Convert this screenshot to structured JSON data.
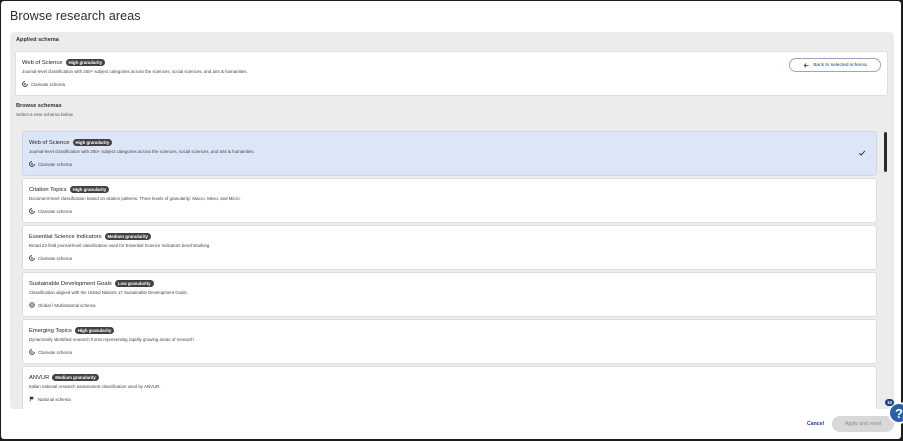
{
  "dialog": {
    "title": "Browse research areas"
  },
  "applied": {
    "section_label": "Applied schema",
    "card": {
      "title": "Web of Science",
      "badge": "High granularity",
      "description": "Journal-level classification with 250+ subject categories across the sciences, social sciences, and arts & humanities.",
      "meta": "Clarivate schema",
      "meta_icon": "clarivate-icon"
    },
    "back_button_label": "Back to selected schema"
  },
  "browse": {
    "section_label": "Browse schemas",
    "subtitle": "Select a new schema below",
    "schemas": [
      {
        "title": "Web of Science",
        "badge": "High granularity",
        "description": "Journal-level classification with 250+ subject categories across the sciences, social sciences, and arts & humanities.",
        "meta": "Clarivate schema",
        "meta_icon": "clarivate-icon",
        "selected": true
      },
      {
        "title": "Citation Topics",
        "badge": "High granularity",
        "description": "Document-level classification based on citation patterns. Three levels of granularity: Macro, Meso, and Micro.",
        "meta": "Clarivate schema",
        "meta_icon": "clarivate-icon",
        "selected": false
      },
      {
        "title": "Essential Science Indicators",
        "badge": "Medium granularity",
        "description": "Broad 22-field journal-level classification used for Essential Science Indicators benchmarking.",
        "meta": "Clarivate schema",
        "meta_icon": "clarivate-icon",
        "selected": false
      },
      {
        "title": "Sustainable Development Goals",
        "badge": "Low granularity",
        "description": "Classification aligned with the United Nations 17 Sustainable Development Goals.",
        "meta": "Global / Multinational schema",
        "meta_icon": "globe-icon",
        "selected": false
      },
      {
        "title": "Emerging Topics",
        "badge": "High granularity",
        "description": "Dynamically identified research fronts representing rapidly growing areas of research",
        "meta": "Clarivate schema",
        "meta_icon": "clarivate-icon",
        "selected": false
      },
      {
        "title": "ANVUR",
        "badge": "Medium granularity",
        "description": "Italian national research assessment classification used by ANVUR.",
        "meta": "National schema",
        "meta_icon": "flag-icon",
        "selected": false
      }
    ]
  },
  "footer": {
    "cancel_label": "Cancel",
    "apply_label": "Apply and reset"
  },
  "help": {
    "glyph": "?",
    "count": "10"
  },
  "colors": {
    "selected_card": "#dde6f7",
    "badge": "#414141",
    "link": "#1d3f7a",
    "help": "#2b5fa6"
  }
}
